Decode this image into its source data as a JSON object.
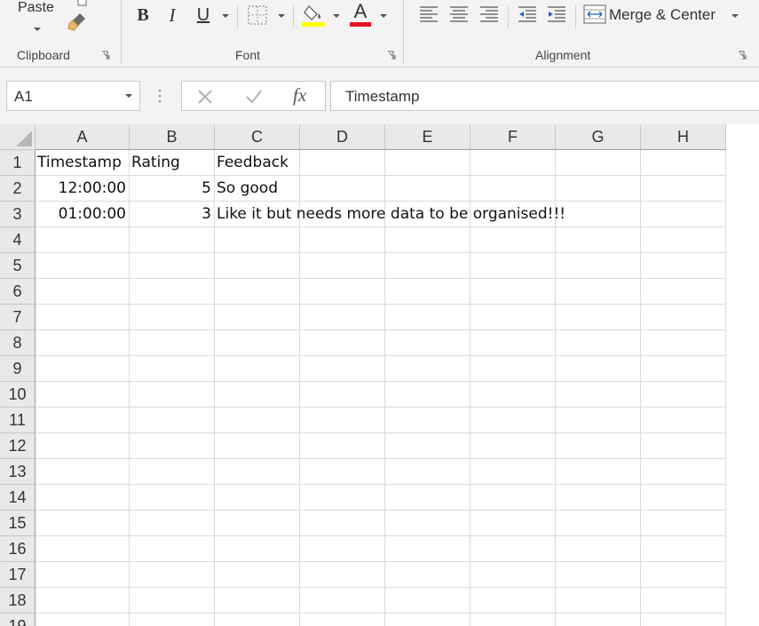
{
  "ribbon": {
    "clipboard": {
      "paste_label": "Paste",
      "group_label": "Clipboard"
    },
    "font": {
      "group_label": "Font",
      "bold": "B",
      "italic": "I",
      "underline": "U",
      "font_color_letter": "A",
      "fill_color": "#ffff00",
      "font_color": "#e81123"
    },
    "alignment": {
      "group_label": "Alignment",
      "merge_label": "Merge & Center"
    }
  },
  "formula_bar": {
    "name_box": "A1",
    "fx": "fx",
    "content": "Timestamp"
  },
  "grid": {
    "columns": [
      "A",
      "B",
      "C",
      "D",
      "E",
      "F",
      "G",
      "H"
    ],
    "rows": [
      "1",
      "2",
      "3",
      "4",
      "5",
      "6",
      "7",
      "8",
      "9",
      "10",
      "11",
      "12",
      "13",
      "14",
      "15",
      "16",
      "17",
      "18",
      "19"
    ],
    "cells": {
      "A1": "Timestamp",
      "B1": "Rating",
      "C1": "Feedback",
      "A2": "12:00:00",
      "B2": "5",
      "C2": "So good",
      "A3": "01:00:00",
      "B3": "3",
      "C3": "Like it but needs more data to be organised!!!"
    }
  }
}
